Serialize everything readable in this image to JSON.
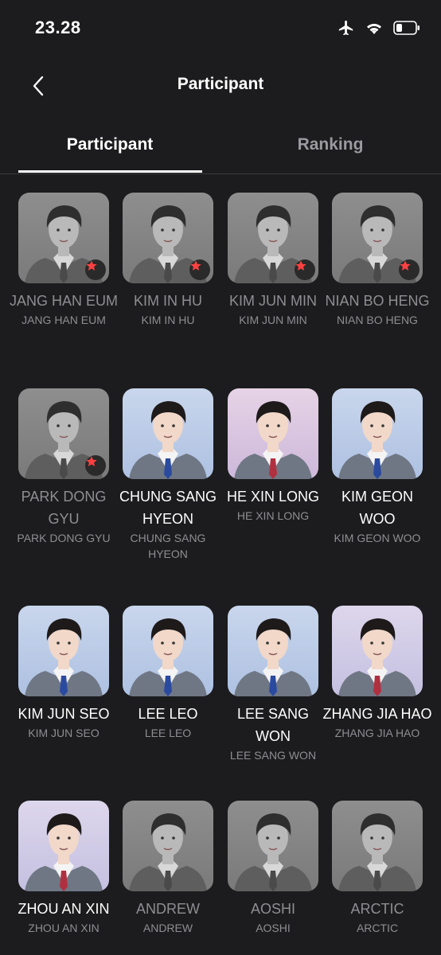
{
  "status": {
    "time": "23.28"
  },
  "header": {
    "title": "Participant"
  },
  "tabs": [
    {
      "label": "Participant",
      "active": true
    },
    {
      "label": "Ranking",
      "active": false
    }
  ],
  "participants": [
    {
      "name": "JANG HAN EUM",
      "sub": "JANG HAN EUM",
      "style": "gray",
      "star": true
    },
    {
      "name": "KIM IN HU",
      "sub": "KIM IN HU",
      "style": "gray",
      "star": true
    },
    {
      "name": "KIM JUN MIN",
      "sub": "KIM JUN MIN",
      "style": "gray",
      "star": true
    },
    {
      "name": "NIAN BO HENG",
      "sub": "NIAN BO HENG",
      "style": "gray",
      "star": true
    },
    {
      "name": "PARK DONG GYU",
      "sub": "PARK DONG GYU",
      "style": "gray",
      "star": true
    },
    {
      "name": "CHUNG SANG HYEON",
      "sub": "CHUNG SANG HYEON",
      "style": "color-blue",
      "star": false
    },
    {
      "name": "HE XIN LONG",
      "sub": "HE XIN LONG",
      "style": "color-pink",
      "star": false
    },
    {
      "name": "KIM GEON WOO",
      "sub": "KIM GEON WOO",
      "style": "color-blue",
      "star": false
    },
    {
      "name": "KIM JUN SEO",
      "sub": "KIM JUN SEO",
      "style": "color-blue",
      "star": false
    },
    {
      "name": "LEE LEO",
      "sub": "LEE LEO",
      "style": "color-blue",
      "star": false
    },
    {
      "name": "LEE SANG WON",
      "sub": "LEE SANG WON",
      "style": "color-blue",
      "star": false
    },
    {
      "name": "ZHANG JIA HAO",
      "sub": "ZHANG JIA HAO",
      "style": "color-lav",
      "star": false
    },
    {
      "name": "ZHOU AN XIN",
      "sub": "ZHOU AN XIN",
      "style": "color-lav",
      "star": false
    },
    {
      "name": "ANDREW",
      "sub": "ANDREW",
      "style": "gray",
      "star": false
    },
    {
      "name": "AOSHI",
      "sub": "AOSHI",
      "style": "gray",
      "star": false
    },
    {
      "name": "ARCTIC",
      "sub": "ARCTIC",
      "style": "gray",
      "star": false
    }
  ]
}
